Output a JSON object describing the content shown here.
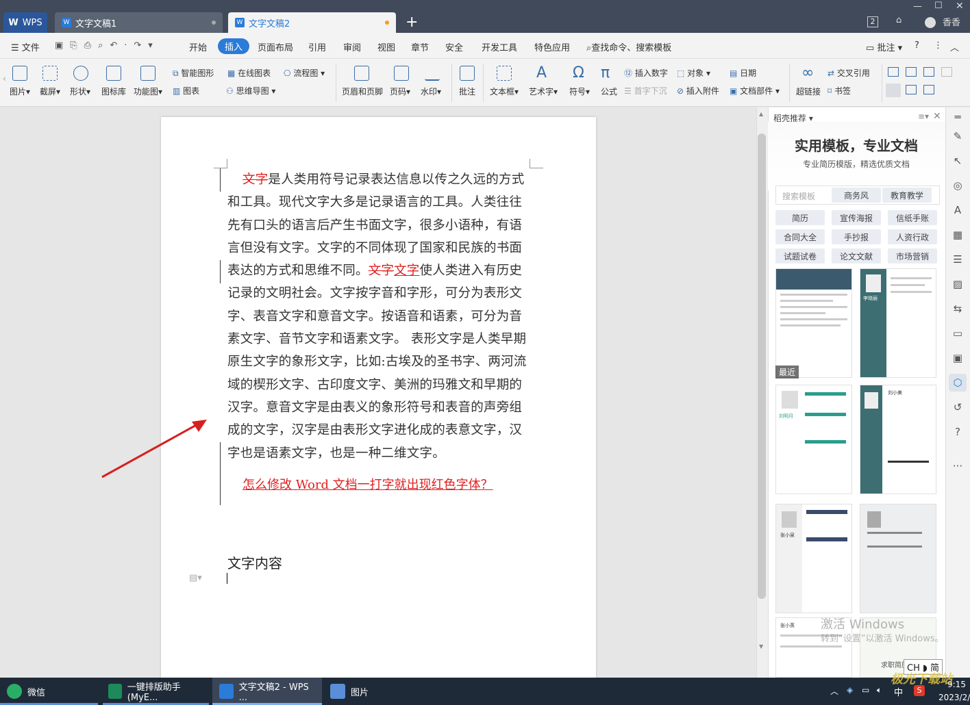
{
  "titlebar": {
    "wps_label": "WPS",
    "tabs": [
      {
        "label": "文字文稿1"
      },
      {
        "label": "文字文稿2"
      }
    ],
    "badge": "2",
    "user": "香香"
  },
  "menu": {
    "file": "文件",
    "items": [
      "开始",
      "插入",
      "页面布局",
      "引用",
      "审阅",
      "视图",
      "章节",
      "安全",
      "开发工具",
      "特色应用"
    ],
    "active": "插入",
    "search": "查找命令、搜索模板",
    "comment": "批注"
  },
  "ribbon": {
    "picture": "图片",
    "screenshot": "截屏",
    "shape": "形状",
    "iconlib": "图标库",
    "funcchart": "功能图",
    "smartshape": "智能图形",
    "onlinechart": "在线图表",
    "flowchart": "流程图",
    "chart": "图表",
    "mindmap": "思维导图",
    "headerfooter": "页眉和页脚",
    "pagenum": "页码",
    "watermark": "水印",
    "annotation": "批注",
    "textbox": "文本框",
    "wordart": "艺术字",
    "symbol": "符号",
    "formula": "公式",
    "insertnum": "插入数字",
    "dropcap": "首字下沉",
    "object": "对象",
    "attachment": "插入附件",
    "date": "日期",
    "docpart": "文档部件",
    "hyperlink": "超链接",
    "crossref": "交叉引用",
    "bookmark": "书签"
  },
  "document": {
    "p1_del": "文字",
    "p1_text": "是人类用符号记录表达信息以传之久远的方式和工具。现代文字大多是记录语言的工具。人类往往先有口头的语言后产生书面文字，很多小语种，有语言但没有文字。文字的不同体现了国家和民族的书面表达的方式和思维不同。",
    "p1_del2": "文字",
    "p1_ins": "文字",
    "p1_text2": "使人类进入有历史记录的文明社会。文字按字音和字形，可分为表形文字、表音文字和意音文字。按语音和语素，可分为音素文字、音节文字和语素文字。 表形文字是人类早期原生文字的象形文字，比如:古埃及的圣书字、两河流域的楔形文字、古印度文字、美洲的玛雅文和早期的汉字。意音文字是由表义的象形符号和表音的声旁组成的文字，汉字是由表形文字进化成的表意文字，汉字也是语素文字，也是一种二维文字。",
    "red_line": "怎么修改 Word 文档一打字就出现红色字体？",
    "heading": "文字内容"
  },
  "panel": {
    "title": "稻壳推荐",
    "headline": "实用模板，专业文档",
    "subline": "专业简历模版，精选优质文档",
    "search_placeholder": "搜索模板",
    "tags_top": [
      "商务风",
      "教育教学"
    ],
    "tags": [
      "简历",
      "宣传海报",
      "信纸手账",
      "合同大全",
      "手抄报",
      "人资行政",
      "试题试卷",
      "论文文献",
      "市场营销"
    ],
    "recent": "最近",
    "thumb_names": [
      "李晓丽",
      "刘明月",
      "张小英",
      "刘小美",
      "张小泉"
    ],
    "activate1": "激活 Windows",
    "activate2": "转到“设置”以激活 Windows。",
    "job": "求职简历"
  },
  "taskbar": {
    "items": [
      "微信",
      "一键排版助手(MyE...",
      "文字文稿2 - WPS ...",
      "图片"
    ],
    "ime": "CH",
    "ime2": "简",
    "ime_lang": "中",
    "time": "9:15",
    "date": "2023/2/",
    "watermark": "极光下载站"
  },
  "colors": {
    "accent": "#2b7bd8",
    "red": "#e02020",
    "titlebar": "#404a5a"
  }
}
